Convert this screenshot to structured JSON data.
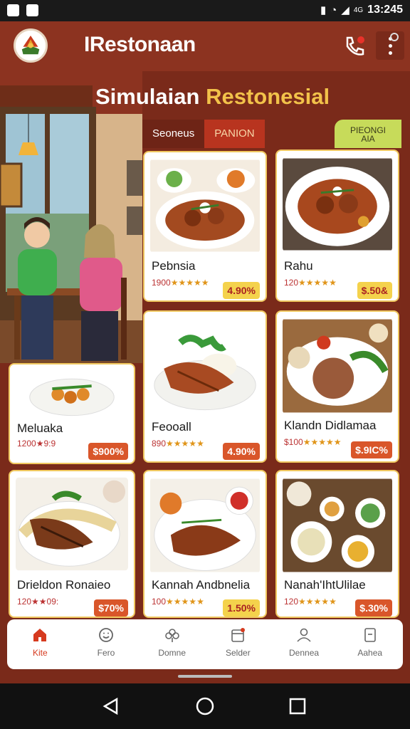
{
  "status": {
    "time": "13:245",
    "network": "4G"
  },
  "app": {
    "title": "IRestonaan"
  },
  "hero": {
    "title_main": "Simulaian",
    "title_accent": "Restonesial"
  },
  "tabs": [
    {
      "label": "Seoneus",
      "active": false
    },
    {
      "label": "PANION",
      "active": true
    }
  ],
  "promo": {
    "line1": "PIEONGI",
    "line2": "AIA"
  },
  "menu": [
    {
      "name": "Pebnsia",
      "rating": "1900",
      "stars": "★★★★★",
      "price": "4.90%",
      "price_style": "yellow"
    },
    {
      "name": "Rahu",
      "rating": "120",
      "stars": "★★★★★",
      "price": "$.50&",
      "price_style": "yellow"
    },
    {
      "name": "Meluaka",
      "rating": "1200★9:9",
      "stars": "",
      "price": "$900%",
      "price_style": "orange"
    },
    {
      "name": "Feooall",
      "rating": "890",
      "stars": "★★★★★",
      "price": "4.90%",
      "price_style": "orange"
    },
    {
      "name": "Klandn Didlamaa",
      "rating": "$100",
      "stars": "★★★★★",
      "price": "$.9IC%",
      "price_style": "orange"
    },
    {
      "name": "Drieldon Ronaieo",
      "rating": "120★★09:",
      "stars": "",
      "price": "$70%",
      "price_style": "orange"
    },
    {
      "name": "Kannah Andbnelia",
      "rating": "100",
      "stars": "★★★★★",
      "price": "1.50%",
      "price_style": "yellow"
    },
    {
      "name": "Nanah'IhtUlilae",
      "rating": "120",
      "stars": "★★★★★",
      "price": "$.30%",
      "price_style": "orange"
    }
  ],
  "bottom_nav": [
    {
      "label": "Kite",
      "icon": "home-icon",
      "active": true
    },
    {
      "label": "Fero",
      "icon": "smile-icon",
      "active": false
    },
    {
      "label": "Domne",
      "icon": "flower-icon",
      "active": false
    },
    {
      "label": "Selder",
      "icon": "calendar-icon",
      "active": false
    },
    {
      "label": "Dennea",
      "icon": "user-icon",
      "active": false
    },
    {
      "label": "Aahea",
      "icon": "clipboard-icon",
      "active": false
    }
  ],
  "colors": {
    "primary": "#8c3320",
    "accent": "#f2c24a",
    "active_tab": "#b8341f",
    "nav_active": "#d63a1f"
  }
}
